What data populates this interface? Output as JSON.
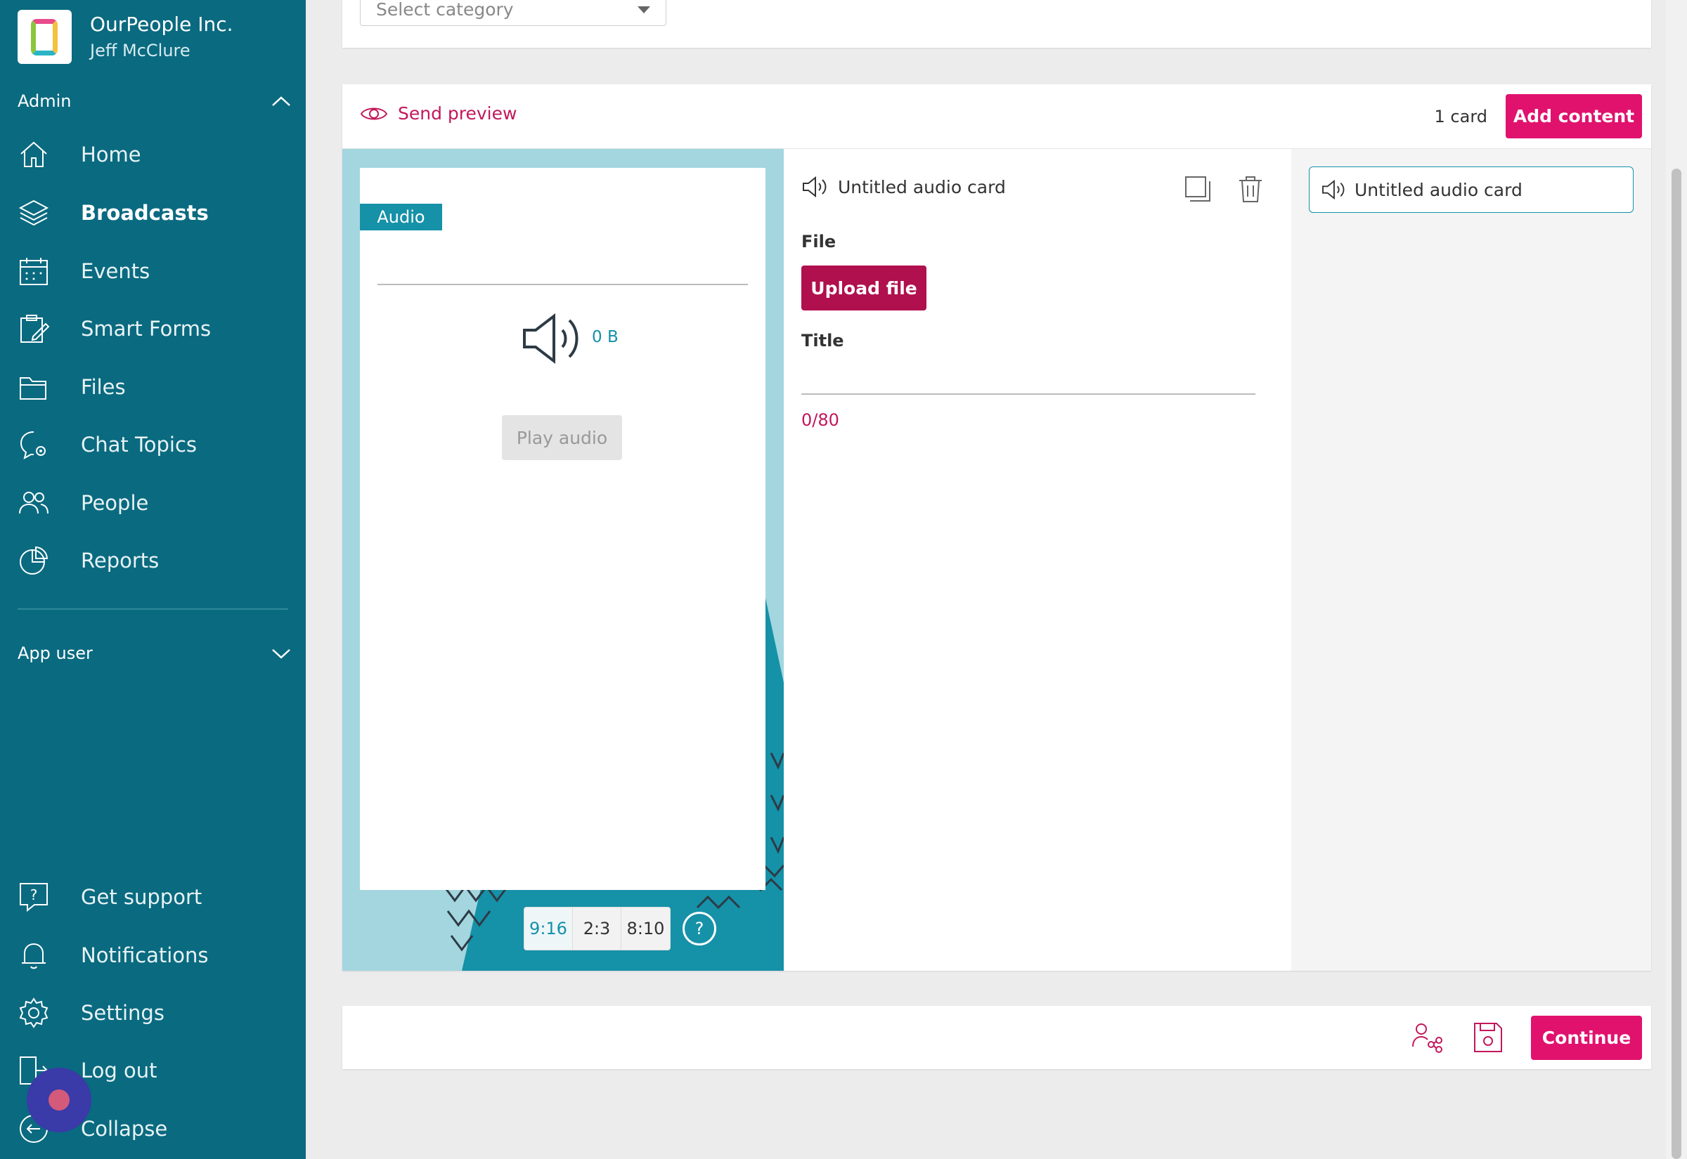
{
  "org": {
    "name": "OurPeople Inc.",
    "user": "Jeff McClure"
  },
  "sidebar": {
    "admin_label": "Admin",
    "app_user_label": "App user",
    "items": [
      {
        "label": "Home",
        "icon": "home-icon"
      },
      {
        "label": "Broadcasts",
        "icon": "layers-icon"
      },
      {
        "label": "Events",
        "icon": "calendar-icon"
      },
      {
        "label": "Smart Forms",
        "icon": "clipboard-icon"
      },
      {
        "label": "Files",
        "icon": "folder-icon"
      },
      {
        "label": "Chat Topics",
        "icon": "chat-gear-icon"
      },
      {
        "label": "People",
        "icon": "people-icon"
      },
      {
        "label": "Reports",
        "icon": "pie-chart-icon"
      }
    ],
    "bottom_items": [
      {
        "label": "Get support",
        "icon": "help-icon"
      },
      {
        "label": "Notifications",
        "icon": "bell-icon"
      },
      {
        "label": "Settings",
        "icon": "gear-icon"
      },
      {
        "label": "Log out",
        "icon": "logout-icon"
      },
      {
        "label": "Collapse",
        "icon": "collapse-icon"
      }
    ]
  },
  "category_select": {
    "placeholder": "Select category"
  },
  "editor": {
    "send_preview": "Send preview",
    "card_count": "1 card",
    "add_content": "Add content",
    "preview": {
      "tag": "Audio",
      "file_size": "0 B",
      "play_audio": "Play audio",
      "ratios": [
        "9:16",
        "2:3",
        "8:10"
      ],
      "help": "?"
    },
    "form": {
      "card_title": "Untitled audio card",
      "file_label": "File",
      "upload_button": "Upload file",
      "title_label": "Title",
      "title_value": "",
      "counter": "0/80"
    },
    "card_list": [
      {
        "label": "Untitled audio card"
      }
    ]
  },
  "footer": {
    "continue": "Continue"
  },
  "colors": {
    "sidebar": "#0a6a80",
    "accent": "#e0126e",
    "teal": "#1591a8",
    "upload": "#b0104d"
  }
}
